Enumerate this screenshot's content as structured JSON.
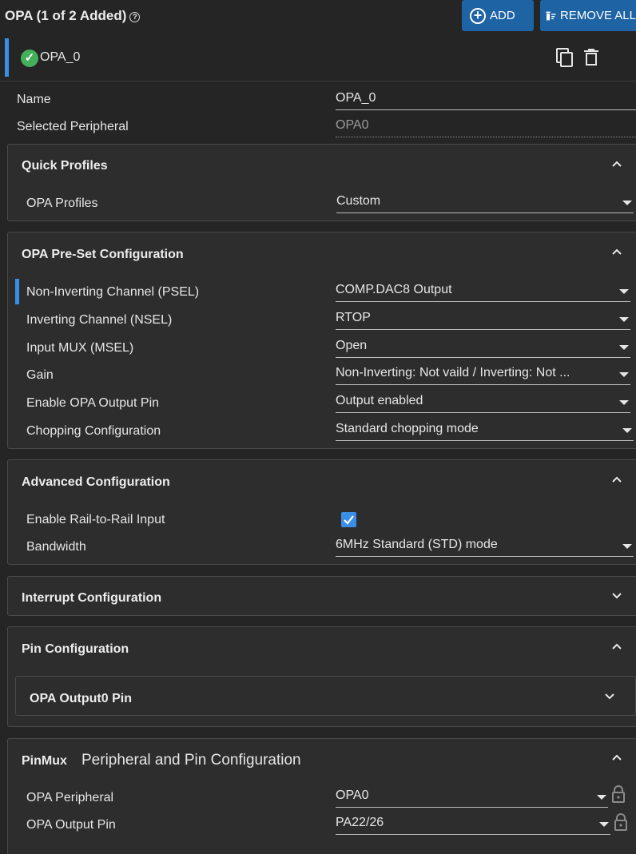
{
  "header": {
    "title": "OPA (1 of 2 Added)",
    "help_icon": "help-circle-icon"
  },
  "toolbar": {
    "add_label": "ADD",
    "remove_label": "REMOVE ALL"
  },
  "instance": {
    "name": "OPA_0",
    "status_icon": "check-circle-icon"
  },
  "basic": {
    "name_label": "Name",
    "name_value": "OPA_0",
    "peripheral_label": "Selected Peripheral",
    "peripheral_value": "OPA0"
  },
  "quick_profiles": {
    "title": "Quick Profiles",
    "profile_label": "OPA Profiles",
    "profile_value": "Custom"
  },
  "preset": {
    "title": "OPA Pre-Set Configuration",
    "rows": [
      {
        "label": "Non-Inverting Channel (PSEL)",
        "value": "COMP.DAC8 Output"
      },
      {
        "label": "Inverting Channel (NSEL)",
        "value": "RTOP"
      },
      {
        "label": "Input MUX (MSEL)",
        "value": "Open"
      },
      {
        "label": "Gain",
        "value": "Non-Inverting: Not vaild / Inverting: Not ..."
      },
      {
        "label": "Enable OPA Output Pin",
        "value": "Output enabled"
      },
      {
        "label": "Chopping Configuration",
        "value": "Standard chopping mode"
      }
    ]
  },
  "advanced": {
    "title": "Advanced Configuration",
    "rail_label": "Enable Rail-to-Rail Input",
    "rail_checked": true,
    "bandwidth_label": "Bandwidth",
    "bandwidth_value": "6MHz Standard (STD) mode"
  },
  "interrupt": {
    "title": "Interrupt Configuration"
  },
  "pins": {
    "title": "Pin Configuration",
    "output_pin_title": "OPA Output0 Pin"
  },
  "pinmux": {
    "title": "PinMux",
    "subtitle": "Peripheral and Pin Configuration",
    "peripheral_label": "OPA Peripheral",
    "peripheral_value": "OPA0",
    "output_label": "OPA Output Pin",
    "output_value": "PA22/26"
  },
  "colors": {
    "accent": "#3a8ee6",
    "button": "#1e63a4",
    "success": "#45b05a",
    "background": "#252526",
    "panel": "#2d2d2d"
  }
}
